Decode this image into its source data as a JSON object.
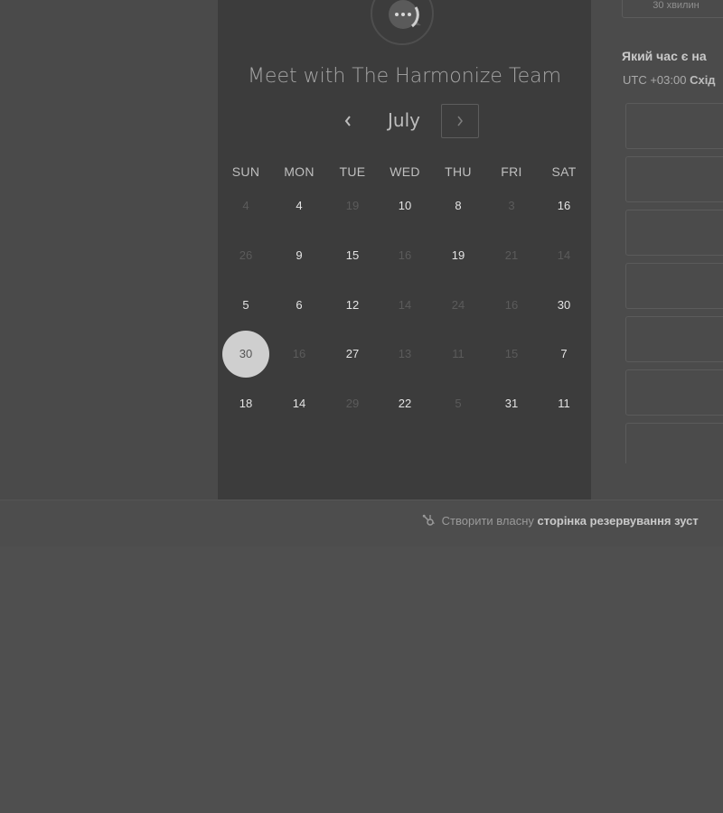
{
  "meeting": {
    "title": "Meet with The Harmonize Team"
  },
  "calendar": {
    "month": "July",
    "prev_icon": "chevron-left-icon",
    "next_icon": "chevron-right-icon",
    "weekdays": [
      "SUN",
      "MON",
      "TUE",
      "WED",
      "THU",
      "FRI",
      "SAT"
    ],
    "weeks": [
      [
        {
          "d": "4",
          "e": false
        },
        {
          "d": "4",
          "e": true
        },
        {
          "d": "19",
          "e": false
        },
        {
          "d": "10",
          "e": true
        },
        {
          "d": "8",
          "e": true
        },
        {
          "d": "3",
          "e": false
        },
        {
          "d": "16",
          "e": true
        }
      ],
      [
        {
          "d": "26",
          "e": false
        },
        {
          "d": "9",
          "e": true
        },
        {
          "d": "15",
          "e": true
        },
        {
          "d": "16",
          "e": false
        },
        {
          "d": "19",
          "e": true
        },
        {
          "d": "21",
          "e": false
        },
        {
          "d": "14",
          "e": false
        }
      ],
      [
        {
          "d": "5",
          "e": true
        },
        {
          "d": "6",
          "e": true
        },
        {
          "d": "12",
          "e": true
        },
        {
          "d": "14",
          "e": false
        },
        {
          "d": "24",
          "e": false
        },
        {
          "d": "16",
          "e": false
        },
        {
          "d": "30",
          "e": true
        }
      ],
      [
        {
          "d": "30",
          "e": true,
          "selected": true
        },
        {
          "d": "16",
          "e": false
        },
        {
          "d": "27",
          "e": true
        },
        {
          "d": "13",
          "e": false
        },
        {
          "d": "11",
          "e": false
        },
        {
          "d": "15",
          "e": false
        },
        {
          "d": "7",
          "e": true
        }
      ],
      [
        {
          "d": "18",
          "e": true
        },
        {
          "d": "14",
          "e": true
        },
        {
          "d": "29",
          "e": false
        },
        {
          "d": "22",
          "e": true
        },
        {
          "d": "5",
          "e": false
        },
        {
          "d": "31",
          "e": true
        },
        {
          "d": "11",
          "e": true
        }
      ]
    ]
  },
  "scheduler": {
    "duration_label": "30 хвилин",
    "question": "Який час є на",
    "timezone_prefix": "UTC +03:00",
    "timezone_name": "Схід",
    "slot_count": 7
  },
  "footer": {
    "icon": "sprocket-icon",
    "prefix": "Створити власну",
    "bold": "сторінка резервування зуст"
  }
}
